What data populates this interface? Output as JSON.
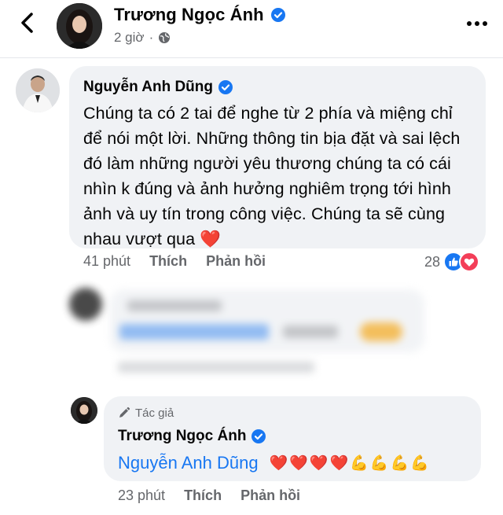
{
  "post": {
    "author": "Trương Ngọc Ánh",
    "time": "2 giờ"
  },
  "comment": {
    "author": "Nguyễn Anh Dũng",
    "text": "Chúng ta có 2 tai để nghe từ 2 phía và miệng chỉ để nói một lời. Những thông tin bịa đặt và sai lệch đó làm những người yêu thương chúng ta có cái nhìn k đúng và ảnh hưởng nghiêm trọng tới hình ảnh và uy tín trong công việc. Chúng ta sẽ cùng nhau vượt qua",
    "emoji": "❤️",
    "time": "41 phút",
    "like_label": "Thích",
    "reply_label": "Phản hồi",
    "reaction_count": "28"
  },
  "reply": {
    "badge": "Tác giả",
    "author": "Trương Ngọc Ánh",
    "mention": "Nguyễn Anh Dũng",
    "emojis": "❤️❤️❤️❤️💪💪💪💪",
    "time": "23 phút",
    "like_label": "Thích",
    "reply_label": "Phản hồi"
  },
  "colors": {
    "accent": "#1877f2",
    "bubble": "#f0f2f5",
    "secondary_text": "#65676b",
    "love": "#f33e58"
  },
  "icons": [
    "back-arrow-icon",
    "verified-badge-icon",
    "globe-icon",
    "more-icon",
    "like-reaction-icon",
    "love-reaction-icon",
    "pencil-icon"
  ]
}
